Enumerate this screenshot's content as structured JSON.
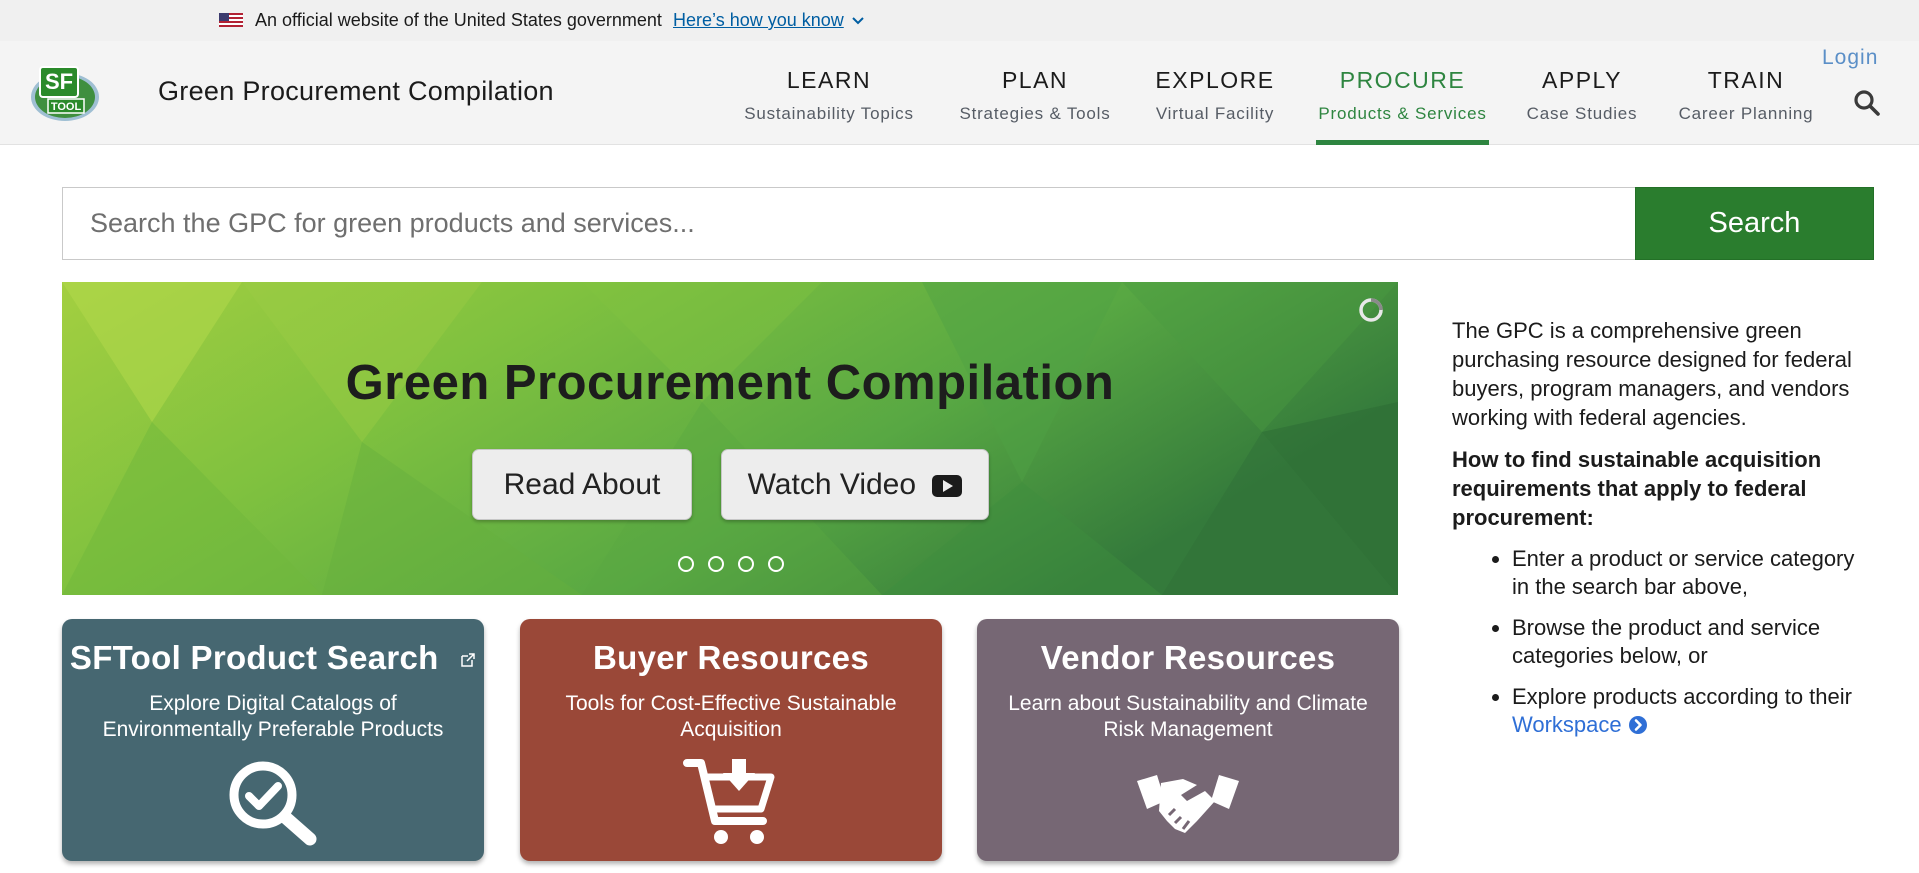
{
  "gov_banner": {
    "text": "An official website of the United States government",
    "link": "Here’s how you know"
  },
  "header": {
    "logo_text_top": "SF",
    "logo_text_bottom": "TOOL",
    "title": "Green Procurement Compilation",
    "login": "Login",
    "nav": [
      {
        "label": "LEARN",
        "sub": "Sustainability Topics"
      },
      {
        "label": "PLAN",
        "sub": "Strategies & Tools"
      },
      {
        "label": "EXPLORE",
        "sub": "Virtual Facility"
      },
      {
        "label": "PROCURE",
        "sub": "Products & Services"
      },
      {
        "label": "APPLY",
        "sub": "Case Studies"
      },
      {
        "label": "TRAIN",
        "sub": "Career Planning"
      }
    ],
    "active_nav": "PROCURE"
  },
  "search": {
    "placeholder": "Search the GPC for green products and services...",
    "value": "",
    "button": "Search"
  },
  "hero": {
    "title": "Green Procurement Compilation",
    "read_button": "Read About",
    "watch_button": "Watch Video",
    "slide_count": 4
  },
  "cards": [
    {
      "title": "SFTool Product Search",
      "desc": "Explore Digital Catalogs of Environmentally Preferable Products",
      "icon": "magnifier-check-icon",
      "color": "#466771"
    },
    {
      "title": "Buyer Resources",
      "desc": "Tools for Cost-Effective Sustainable Acquisition",
      "icon": "shopping-cart-download-icon",
      "color": "#9a4838"
    },
    {
      "title": "Vendor Resources",
      "desc": "Learn about Sustainability and Climate Risk Management",
      "icon": "handshake-icon",
      "color": "#766774"
    }
  ],
  "sidebar": {
    "intro": "The GPC is a comprehensive green purchasing resource designed for federal buyers, program managers, and vendors working with federal agencies.",
    "heading": "How to find sustainable acquisition requirements that apply to federal procurement:",
    "items": [
      "Enter a product or service category in the search bar above,",
      "Browse the product and service categories below, or"
    ],
    "item3_prefix": "Explore products according to their",
    "item3_link": "Workspace"
  },
  "colors": {
    "brand_green": "#2e8540",
    "search_green": "#2a7d2e",
    "link_blue": "#005ea2"
  }
}
